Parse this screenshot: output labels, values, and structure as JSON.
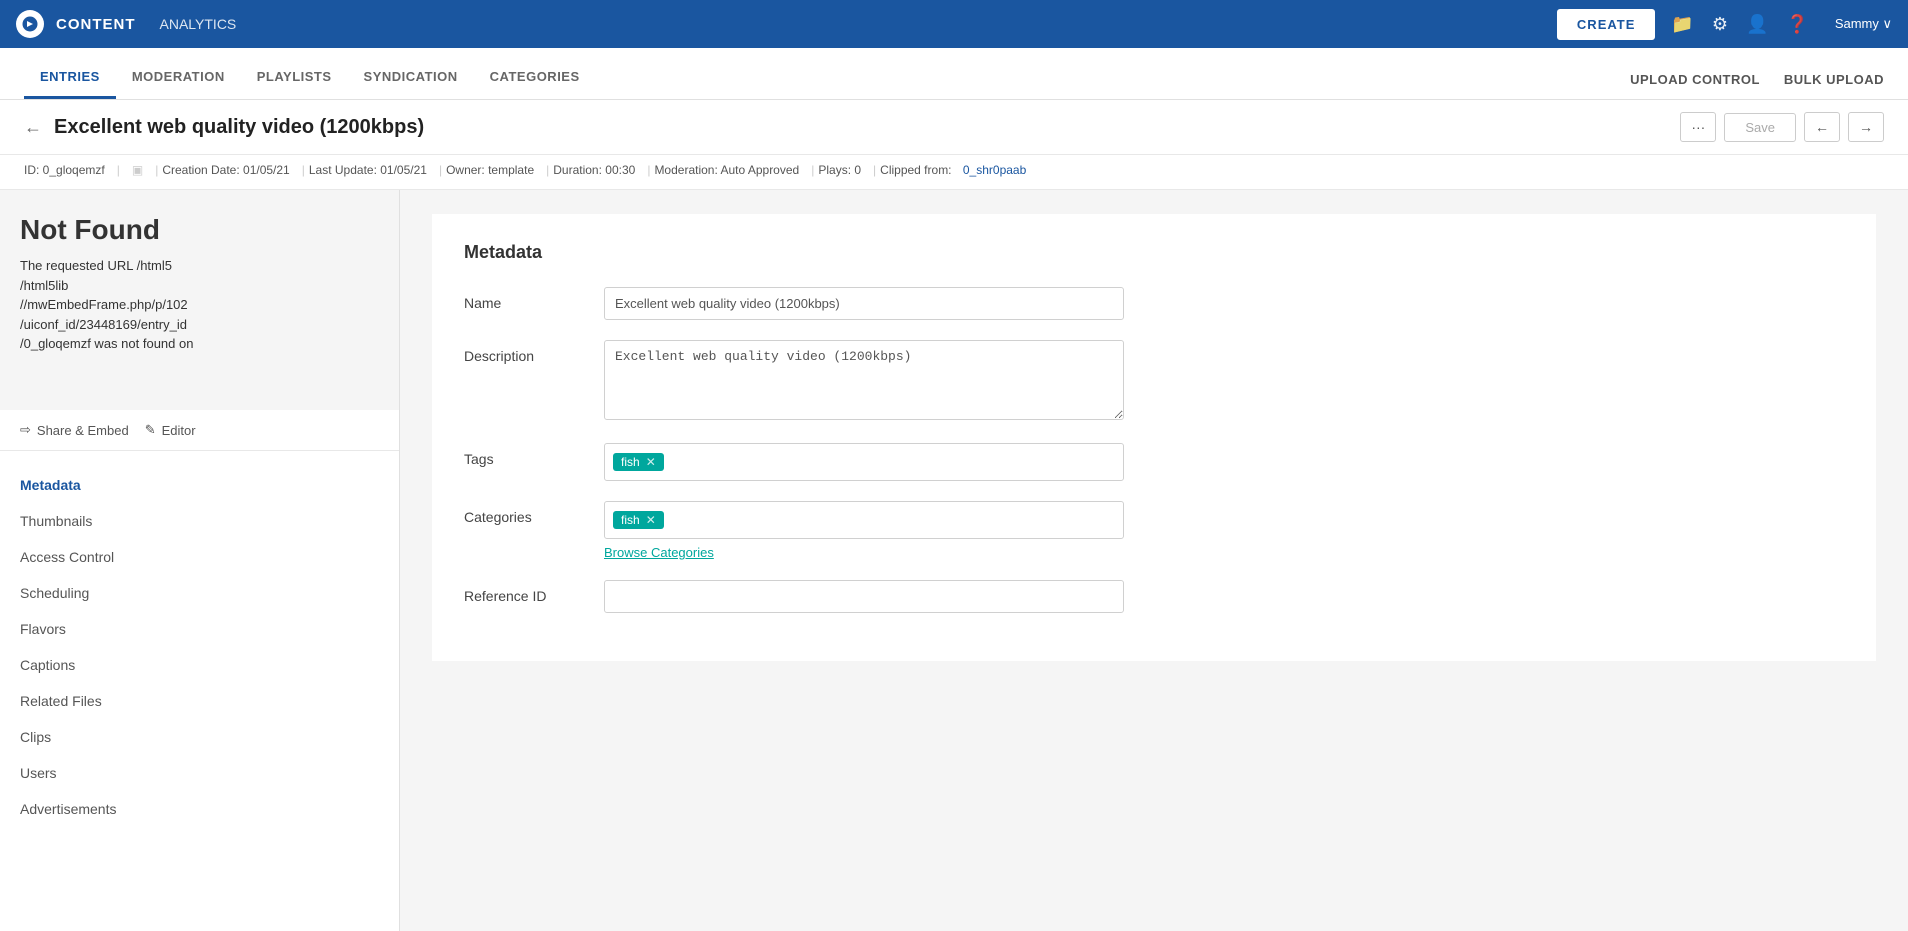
{
  "topnav": {
    "title": "CONTENT",
    "analytics": "ANALYTICS",
    "create_label": "CREATE",
    "user": "Sammy ∨"
  },
  "subnav": {
    "tabs": [
      {
        "label": "ENTRIES",
        "active": true
      },
      {
        "label": "MODERATION",
        "active": false
      },
      {
        "label": "PLAYLISTS",
        "active": false
      },
      {
        "label": "SYNDICATION",
        "active": false
      },
      {
        "label": "CATEGORIES",
        "active": false
      }
    ],
    "right_links": [
      "UPLOAD CONTROL",
      "BULK UPLOAD"
    ]
  },
  "entry": {
    "title": "Excellent web quality video (1200kbps)",
    "id": "ID: 0_gloqemzf",
    "creation_date": "Creation Date: 01/05/21",
    "last_update": "Last Update: 01/05/21",
    "owner": "Owner: template",
    "duration": "Duration: 00:30",
    "moderation": "Moderation: Auto Approved",
    "plays": "Plays: 0",
    "clipped_from_label": "Clipped from:",
    "clipped_from_link": "0_shr0paab"
  },
  "preview": {
    "not_found_title": "Not Found",
    "not_found_text": "The requested URL /html5\n/html5lib\n//mwEmbedFrame.php/p/102\n/uiconf_id/23448169/entry_id\n/0_gloqemzf was not found on",
    "share_embed_label": "Share & Embed",
    "editor_label": "Editor"
  },
  "sidebar": {
    "items": [
      {
        "label": "Metadata",
        "active": true
      },
      {
        "label": "Thumbnails",
        "active": false
      },
      {
        "label": "Access Control",
        "active": false
      },
      {
        "label": "Scheduling",
        "active": false
      },
      {
        "label": "Flavors",
        "active": false
      },
      {
        "label": "Captions",
        "active": false
      },
      {
        "label": "Related Files",
        "active": false
      },
      {
        "label": "Clips",
        "active": false
      },
      {
        "label": "Users",
        "active": false
      },
      {
        "label": "Advertisements",
        "active": false
      }
    ]
  },
  "metadata": {
    "section_title": "Metadata",
    "fields": {
      "name_label": "Name",
      "name_value": "Excellent web quality video (1200kbps)",
      "description_label": "Description",
      "description_value": "Excellent web quality video (1200kbps)",
      "tags_label": "Tags",
      "tags": [
        {
          "label": "fish"
        }
      ],
      "categories_label": "Categories",
      "categories": [
        {
          "label": "fish"
        }
      ],
      "browse_categories": "Browse Categories",
      "reference_id_label": "Reference ID",
      "reference_id_value": ""
    }
  },
  "buttons": {
    "more": "···",
    "save": "Save",
    "nav_prev": "←",
    "nav_next": "→"
  }
}
